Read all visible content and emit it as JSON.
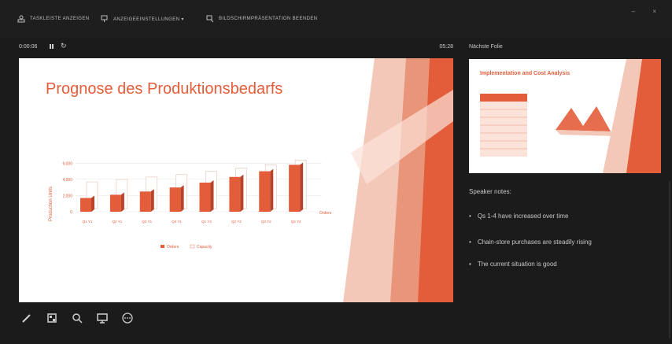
{
  "toolbar": {
    "items": [
      {
        "label": "TASKLEISTE ANZEIGEN",
        "icon": "taskbar-icon"
      },
      {
        "label": "ANZEIGEEINSTELLUNGEN ▾",
        "icon": "display-settings-icon"
      },
      {
        "label": "BILDSCHIRMPRÄSENTATION BEENDEN",
        "icon": "end-show-icon"
      }
    ],
    "window_controls": "– ×"
  },
  "presenter": {
    "elapsed": "0:00:06",
    "clock": "05:28",
    "restart_symbol": "↻"
  },
  "current_slide": {
    "title": "Prognose des Produktionsbedarfs"
  },
  "chart_data": {
    "type": "bar",
    "title": "",
    "categories": [
      "Q1 Y1",
      "Q2 Y1",
      "Q3 Y1",
      "Q4 Y1",
      "Q1 Y2",
      "Q2 Y2",
      "Q3 Y2",
      "Q4 Y2"
    ],
    "series": [
      {
        "name": "Orders",
        "values": [
          1700,
          2100,
          2500,
          3000,
          3600,
          4300,
          5000,
          5800
        ]
      },
      {
        "name": "Capacity",
        "values": [
          3300,
          3600,
          3900,
          4200,
          4600,
          5000,
          5400,
          6000
        ]
      }
    ],
    "ylabel": "Production Units",
    "xlabel": "Orders",
    "yticks": [
      "0",
      "2,000",
      "4,000",
      "6,000"
    ],
    "ylim": [
      0,
      7000
    ],
    "legend": "bottom",
    "colors": {
      "orders": "#e35d3a",
      "capacity": "#ffffff"
    }
  },
  "next_slide": {
    "label": "Nächste Folie",
    "title": "Implementation and Cost Analysis"
  },
  "notes": {
    "heading": "Speaker notes:",
    "items": [
      "Qs 1-4 have increased over time",
      "Chain-store purchases are steadily rising",
      "The current situation is good"
    ]
  },
  "tools": [
    "pen-icon",
    "slides-grid-icon",
    "zoom-icon",
    "screen-icon",
    "more-icon"
  ],
  "colors": {
    "accent": "#e35d3a",
    "background": "#1b1b1b"
  }
}
